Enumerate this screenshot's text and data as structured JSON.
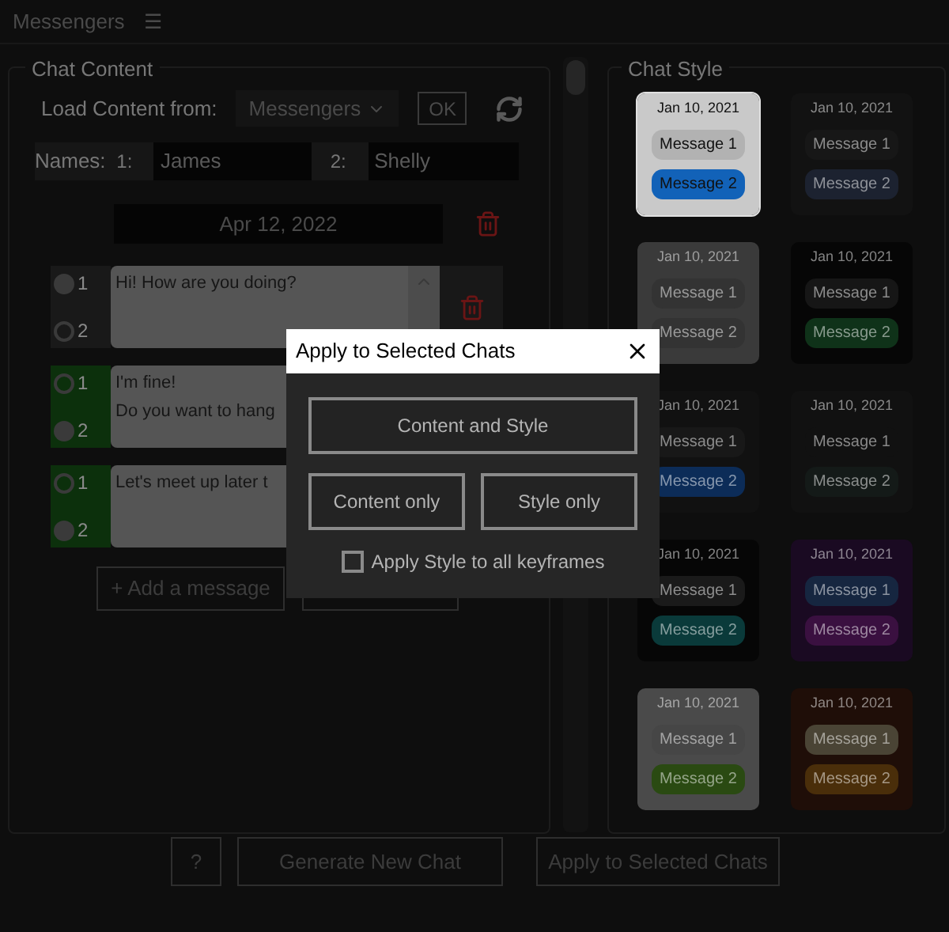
{
  "panel_title": "Messengers",
  "menu_icon": "☰",
  "chat_content": {
    "legend": "Chat Content",
    "load_label": "Load Content from:",
    "source": "Messengers",
    "ok": "OK",
    "names_label": "Names:",
    "names": [
      {
        "index": "1:",
        "value": "James"
      },
      {
        "index": "2:",
        "value": "Shelly"
      }
    ],
    "date": "Apr 12, 2022",
    "messages": [
      {
        "text": "Hi! How are you doing?",
        "selected": false,
        "show_delete": true,
        "senders": [
          {
            "label": "1",
            "selected": true
          },
          {
            "label": "2",
            "selected": false
          }
        ]
      },
      {
        "text": "I'm fine!\nDo you want to hang",
        "selected": true,
        "show_delete": false,
        "senders": [
          {
            "label": "1",
            "selected": false
          },
          {
            "label": "2",
            "selected": true
          }
        ]
      },
      {
        "text": "Let's meet up later t",
        "selected": true,
        "show_delete": false,
        "senders": [
          {
            "label": "1",
            "selected": false
          },
          {
            "label": "2",
            "selected": true
          }
        ]
      }
    ],
    "add_message": "+ Add a message"
  },
  "chat_style": {
    "legend": "Chat Style",
    "cards": [
      {
        "selected": true,
        "color": "#c9c9c9",
        "date": "Jan 10, 2021",
        "bubbles": [
          {
            "text": "Message 1",
            "color": "#b2b2b2"
          },
          {
            "text": "Message 2",
            "color": "#1262b8"
          }
        ]
      },
      {
        "selected": false,
        "color": "#121212",
        "date": "Jan 10, 2021",
        "bubbles": [
          {
            "text": "Message 1",
            "color": "#171717"
          },
          {
            "text": "Message 2",
            "color": "#1c2230"
          }
        ]
      },
      {
        "selected": false,
        "color": "#3a3a3a",
        "date": "Jan 10, 2021",
        "bubbles": [
          {
            "text": "Message 1",
            "color": "#333333"
          },
          {
            "text": "Message 2",
            "color": "#333333"
          }
        ]
      },
      {
        "selected": false,
        "color": "#060606",
        "date": "Jan 10, 2021",
        "bubbles": [
          {
            "text": "Message 1",
            "color": "#161616"
          },
          {
            "text": "Message 2",
            "color": "#0f3219"
          }
        ]
      },
      {
        "selected": false,
        "color": "#111111",
        "date": "Jan 10, 2021",
        "bubbles": [
          {
            "text": "Message 1",
            "color": "#181818"
          },
          {
            "text": "Message 2",
            "color": "#0c2c58"
          }
        ]
      },
      {
        "selected": false,
        "color": "#111111",
        "date": "Jan 10, 2021",
        "bubbles": [
          {
            "text": "Message 1",
            "color": "#111111"
          },
          {
            "text": "Message 2",
            "color": "#141a18"
          }
        ]
      },
      {
        "selected": false,
        "color": "#060606",
        "date": "Jan 10, 2021",
        "bubbles": [
          {
            "text": "Message 1",
            "color": "#1a1a1a"
          },
          {
            "text": "Message 2",
            "color": "#0a3a3a"
          }
        ]
      },
      {
        "selected": false,
        "color": "#1a0a22",
        "date": "Jan 10, 2021",
        "bubbles": [
          {
            "text": "Message 1",
            "color": "#162640"
          },
          {
            "text": "Message 2",
            "color": "#3a1040"
          }
        ]
      },
      {
        "selected": false,
        "color": "#4a4a4a",
        "date": "Jan 10, 2021",
        "bubbles": [
          {
            "text": "Message 1",
            "color": "#464646"
          },
          {
            "text": "Message 2",
            "color": "#2a4a12"
          }
        ]
      },
      {
        "selected": false,
        "color": "#1f0e08",
        "date": "Jan 10, 2021",
        "bubbles": [
          {
            "text": "Message 1",
            "color": "#4a4435"
          },
          {
            "text": "Message 2",
            "color": "#4a2e0a"
          }
        ]
      }
    ]
  },
  "footer": {
    "help": "?",
    "generate": "Generate New Chat",
    "apply": "Apply to Selected Chats"
  },
  "dialog": {
    "title": "Apply to Selected Chats",
    "buttons": [
      "Content and Style",
      "Content only",
      "Style only"
    ],
    "checkbox": {
      "label": "Apply Style to all keyframes",
      "checked": false
    }
  }
}
